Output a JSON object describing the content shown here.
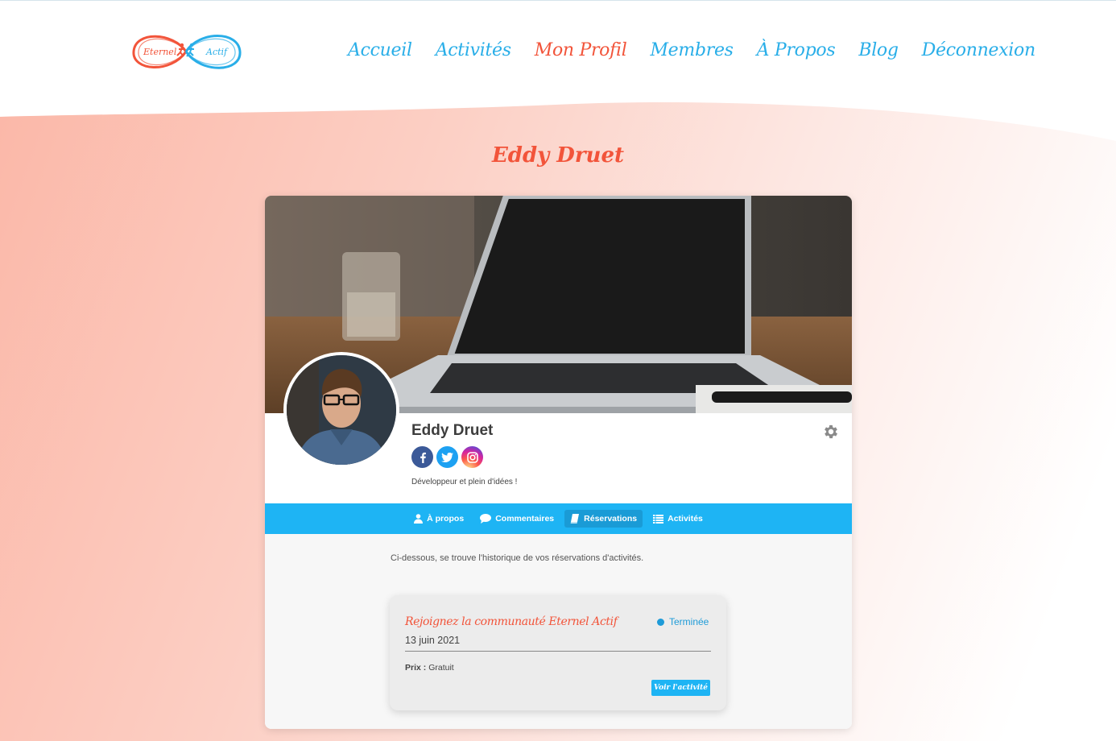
{
  "logo": {
    "text_left": "Eternel",
    "text_right": "Actif"
  },
  "nav": {
    "items": [
      {
        "label": "Accueil"
      },
      {
        "label": "Activités"
      },
      {
        "label": "Mon Profil"
      },
      {
        "label": "Membres"
      },
      {
        "label": "À Propos"
      },
      {
        "label": "Blog"
      },
      {
        "label": "Déconnexion"
      }
    ],
    "active": "Mon Profil"
  },
  "page_title": "Eddy Druet",
  "profile": {
    "name": "Eddy Druet",
    "bio": "Développeur et plein d'idées !",
    "socials": [
      "facebook-icon",
      "twitter-icon",
      "instagram-icon"
    ]
  },
  "tabs": [
    {
      "label": "À propos",
      "icon": "user-icon"
    },
    {
      "label": "Commentaires",
      "icon": "comment-icon"
    },
    {
      "label": "Réservations",
      "icon": "book-icon"
    },
    {
      "label": "Activités",
      "icon": "list-icon"
    }
  ],
  "active_tab": "Réservations",
  "reservations": {
    "intro": "Ci-dessous, se trouve l'historique de vos réservations d'activités.",
    "items": [
      {
        "title": "Rejoignez la communauté Eternel Actif",
        "date": "13 juin 2021",
        "status": "Terminée",
        "price_label": "Prix :",
        "price_value": "Gratuit",
        "button": "Voir l'activité"
      }
    ]
  },
  "colors": {
    "accent": "#f2543a",
    "primary": "#1eb4f4",
    "nav_blue": "#29aee8"
  }
}
